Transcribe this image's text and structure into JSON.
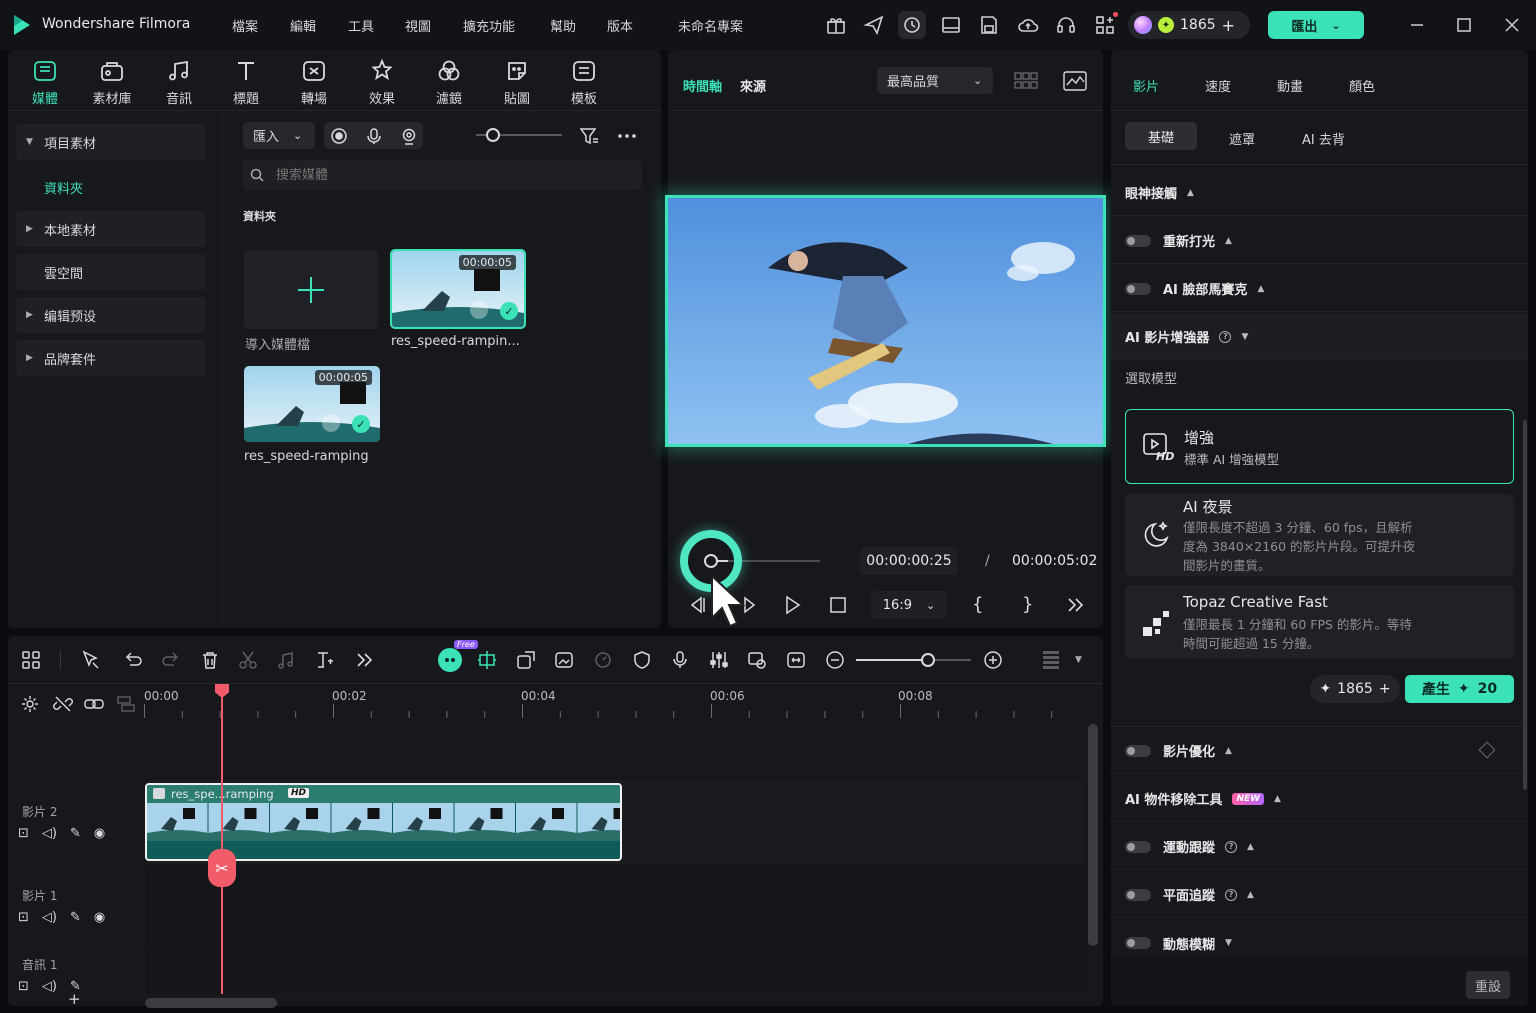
{
  "app": {
    "name": "Wondershare Filmora",
    "project_title": "未命名專案"
  },
  "menu": [
    "檔案",
    "編輯",
    "工具",
    "視圖",
    "擴充功能",
    "幫助",
    "版本"
  ],
  "credits": {
    "count": "1865"
  },
  "export_label": "匯出",
  "toolbar_tabs": [
    "媒體",
    "素材庫",
    "音訊",
    "標題",
    "轉場",
    "效果",
    "濾鏡",
    "貼圖",
    "模板"
  ],
  "sidebar": {
    "items": [
      {
        "label": "項目素材",
        "caret": "▼"
      },
      {
        "label": "資料夾",
        "caret": ""
      },
      {
        "label": "本地素材",
        "caret": "▶"
      },
      {
        "label": "雲空間",
        "caret": ""
      },
      {
        "label": "编辑预设",
        "caret": "▶"
      },
      {
        "label": "品牌套件",
        "caret": "▶"
      }
    ]
  },
  "media": {
    "import_label": "匯入",
    "search_placeholder": "搜索媒體",
    "folder_label": "資料夾",
    "import_tile_label": "導入媒體檔",
    "clips": [
      {
        "name": "res_speed-rampin...",
        "duration": "00:00:05"
      },
      {
        "name": "res_speed-ramping",
        "duration": "00:00:05"
      }
    ]
  },
  "preview": {
    "tabs": [
      "時間軸",
      "來源"
    ],
    "quality": "最高品質",
    "current_time": "00:00:00:25",
    "separator": "/",
    "total_time": "00:00:05:02",
    "aspect": "16:9",
    "progress": 0.18
  },
  "right_panel": {
    "tabs": [
      "影片",
      "速度",
      "動畫",
      "顏色"
    ],
    "subtabs": [
      "基礎",
      "遮罩",
      "AI 去背"
    ],
    "rows": {
      "eye_contact": "眼神接觸",
      "relight": "重新打光",
      "face_mosaic": "AI 臉部馬賽克",
      "enhancer": "AI 影片增強器",
      "select_model": "選取模型"
    },
    "models": [
      {
        "title": "增強",
        "desc": "標準 AI 增強模型",
        "icon_text": "HD"
      },
      {
        "title": "AI 夜景",
        "desc": [
          "僅限長度不超過 3 分鐘、60 fps，且解析",
          "度為 3840×2160 的影片片段。可提升夜",
          "間影片的畫質。"
        ]
      },
      {
        "title": "Topaz Creative Fast",
        "desc": [
          "僅限最長 1 分鐘和 60 FPS 的影片。等待",
          "時間可能超過 15 分鐘。"
        ]
      }
    ],
    "credits_small": "1865",
    "generate_label": "產生",
    "generate_cost": "20",
    "rows2": {
      "optimize": "影片優化",
      "object_removal": "AI 物件移除工具",
      "new_badge": "NEW",
      "motion_track": "運動跟蹤",
      "planar_track": "平面追蹤",
      "motion_blur": "動態模糊"
    },
    "reset_label": "重設"
  },
  "timeline": {
    "free_badge": "Free",
    "ruler": [
      "00:00",
      "00:02",
      "00:04",
      "00:06",
      "00:08"
    ],
    "tracks": [
      "影片 2",
      "影片 1",
      "音訊 1"
    ],
    "clip_label": "res_spe...ramping",
    "clip_badge": "HD",
    "add_label": "+"
  },
  "colors": {
    "accent": "#3be2b8",
    "playhead": "#f25c6a"
  }
}
